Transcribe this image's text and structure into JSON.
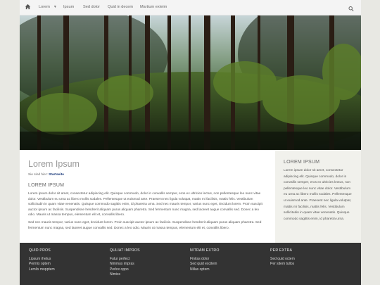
{
  "nav": {
    "home_icon": "home-icon",
    "search_icon": "search-icon",
    "items": [
      "Lorem",
      "Ipsum",
      "Sed dolor",
      "Quid in decem",
      "Martium exteim"
    ]
  },
  "hero": {
    "alt": "forest-photo"
  },
  "main": {
    "title": "Lorem Ipsum",
    "breadcrumb_prefix": "Sie sind hier:",
    "breadcrumb_current": "Startseite",
    "subtitle": "LOREM IPSUM",
    "para1": "Lorem ipsum dolor sit amet, consectetur adipiscing elit. Quisque commodo, dolor in convallis semper, eros ex ultricies lectus, non pellentesque leo nunc vitae dolor. Vestibulum eu urna ac libero mollis sodales. Pellentesque ut euismod ante. Praesent nec ligula volutpat, mattis mi facilisis, mattis felis. Vestibulum sollicitudin in quam vitae venenatis. Quisque commodo sagittis enim, id pharetra urna. Sed nec mauris tempor, varius nunc eget, tincidunt lorem. Proin suscipit auctor ipsum ac facilisis. Suspendisse hendrerit aliquam purus aliquam pharetra. Sed fermentum nunc magna, sed laoreet augue convallis sed. Donec a leo odio. Mauris ut massa tempus, elementum elit et, convallis libero.",
    "para2": "Sed nec mauris tempor, varius nunc eget, tincidunt lorem. Proin suscipit auctor ipsum ac facilisis. Suspendisse hendrerit aliquam purus aliquam pharetra. Sed fermentum nunc magna, sed laoreet augue convallis sed. Donec a leo odio. Mauris ut massa tempus, elementum elit et, convallis libero."
  },
  "aside": {
    "title": "LOREM IPSUM",
    "text": "Lorem ipsum dolor sit amet, consectetur adipiscing elit. Quisque commodo, dolor in convallis semper, eros ex ultricies lectus, non pellentesque leo nunc vitae dolor. Vestibulum eu urna ac libero mollis sodales. Pellentesque ut euismod ante. Praesent nec ligula volutpat, mattis mi facilisis, mattis felis. Vestibulum sollicitudin in quam vitae venenatis. Quisque commodo sagittis enim, id pharetra urna."
  },
  "footer": {
    "columns": [
      {
        "title": "QUID PROS",
        "links": [
          "Lipsum rhetus",
          "Permix optem",
          "Lemlix mopptem"
        ]
      },
      {
        "title": "QULIAT IMPROS",
        "links": [
          "Futur perfect",
          "Nimmus impras",
          "Perlox oppo",
          "Nimiss"
        ]
      },
      {
        "title": "NITRAM EXTRO",
        "links": [
          "Finitas dolor",
          "Sed quid excitem",
          "Nillas optem"
        ]
      },
      {
        "title": "PER EXTRA",
        "links": [
          "Sed quid octem",
          "Per sitem tullos"
        ]
      }
    ]
  },
  "colors": {
    "page_bg": "#e8e8e3",
    "footer_bg": "#333333",
    "aside_bg": "#f1f1ec",
    "link": "#1a3a7a"
  }
}
